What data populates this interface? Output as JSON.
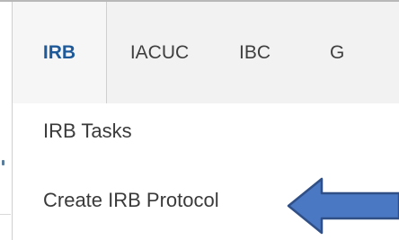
{
  "tabs": [
    {
      "label": "IRB",
      "active": true
    },
    {
      "label": "IACUC",
      "active": false
    },
    {
      "label": "IBC",
      "active": false
    },
    {
      "label": "G",
      "active": false
    }
  ],
  "menu": {
    "items": [
      {
        "label": "IRB Tasks"
      },
      {
        "label": "Create IRB Protocol"
      }
    ]
  },
  "annotation": {
    "icon": "left-arrow-icon",
    "fill": "#4a78c2",
    "stroke": "#2f4f86"
  },
  "colors": {
    "active_tab_text": "#1e5a9a",
    "tab_text": "#3f3f3f",
    "tabbar_bg": "#f2f2f2",
    "menu_text": "#3a3a3a"
  }
}
